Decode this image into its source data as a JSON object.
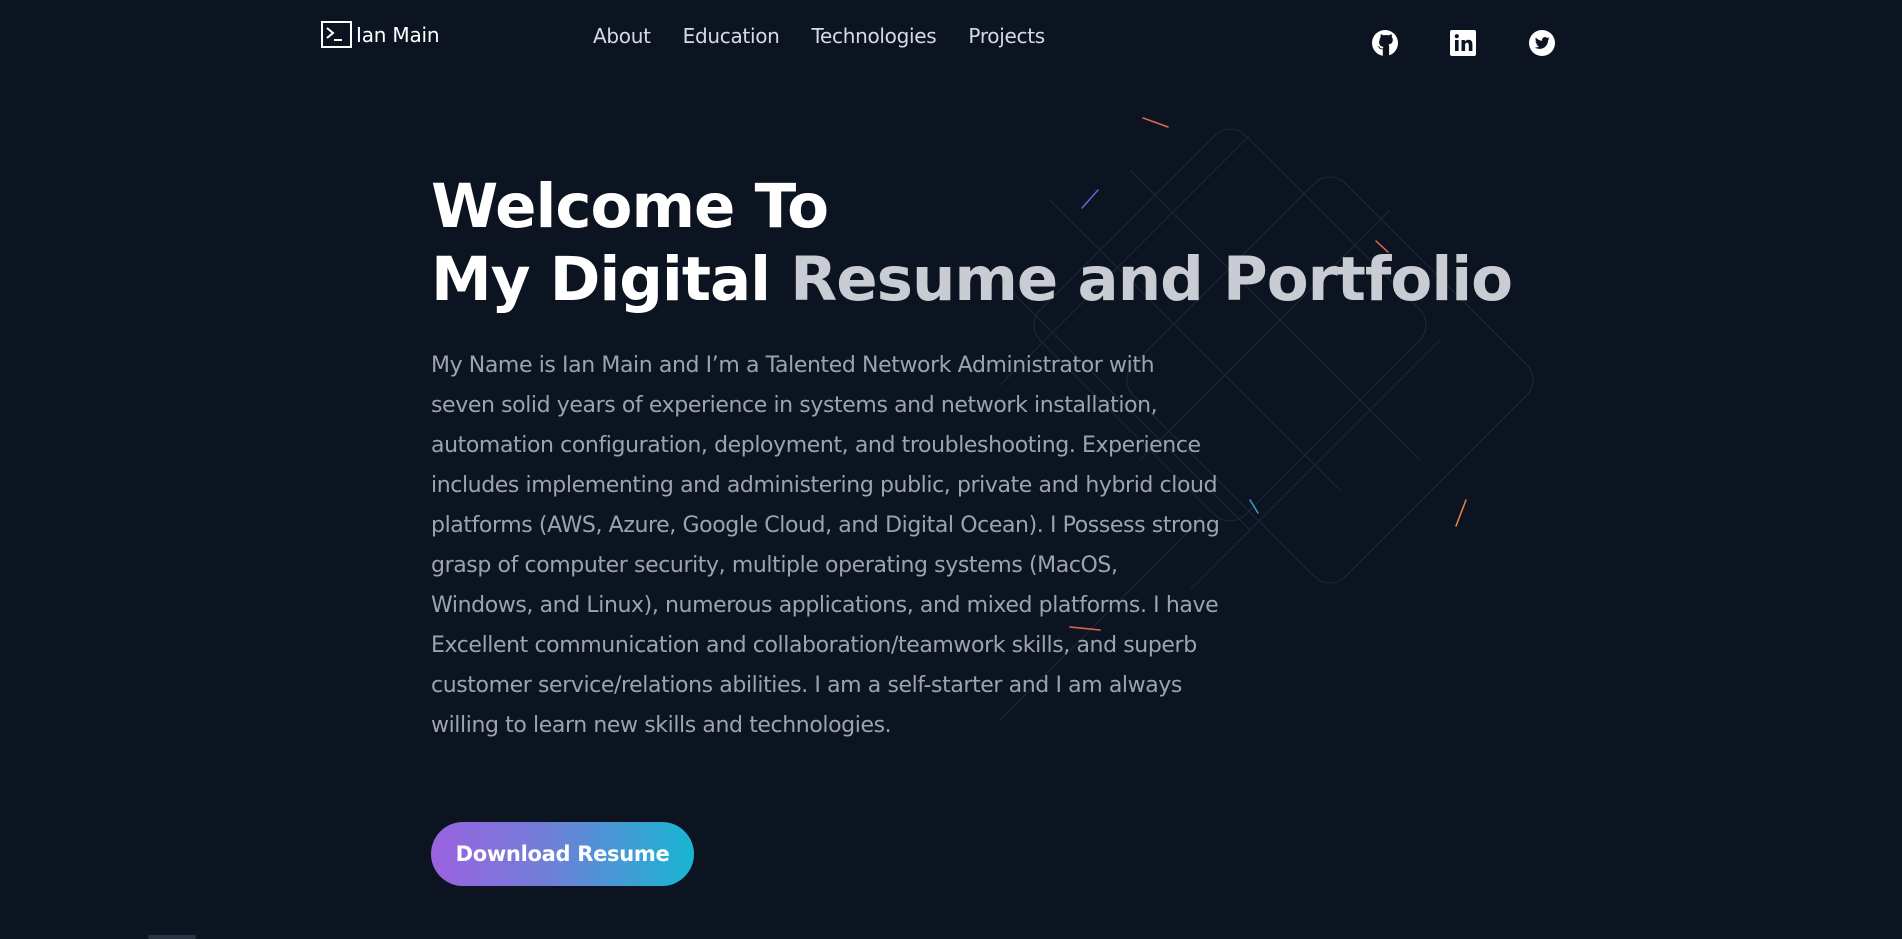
{
  "header": {
    "brand": {
      "icon": "terminal-icon",
      "name": "Ian Main"
    },
    "nav": [
      {
        "label": "About"
      },
      {
        "label": "Education"
      },
      {
        "label": "Technologies"
      },
      {
        "label": "Projects"
      }
    ],
    "social": [
      {
        "icon": "github-icon"
      },
      {
        "icon": "linkedin-icon"
      },
      {
        "icon": "twitter-icon"
      }
    ]
  },
  "hero": {
    "title_line1": "Welcome To",
    "title_line2_part1": "My Digital ",
    "title_line2_part2": "Resume and Portfolio",
    "description": "My Name is Ian Main and I’m a Talented Network Administrator with seven solid years of experience in systems and network installation, automation configuration, deployment, and troubleshooting. Experience includes implementing and administering public, private and hybrid cloud platforms (AWS, Azure, Google Cloud, and Digital Ocean). I Possess strong grasp of computer security, multiple operating systems (MacOS, Windows, and Linux), numerous applications, and mixed platforms. I have Excellent communication and collaboration/teamwork skills, and superb customer service/relations abilities. I am a self-starter and I am always willing to learn new skills and technologies.",
    "button_label": "Download Resume"
  },
  "colors": {
    "background": "#0d1421",
    "nav_text": "#d6dae2",
    "body_text": "#9ca3af",
    "title_accent": "#c9ccd3",
    "button_gradient_start": "#9b62e0",
    "button_gradient_end": "#17b6d2"
  }
}
